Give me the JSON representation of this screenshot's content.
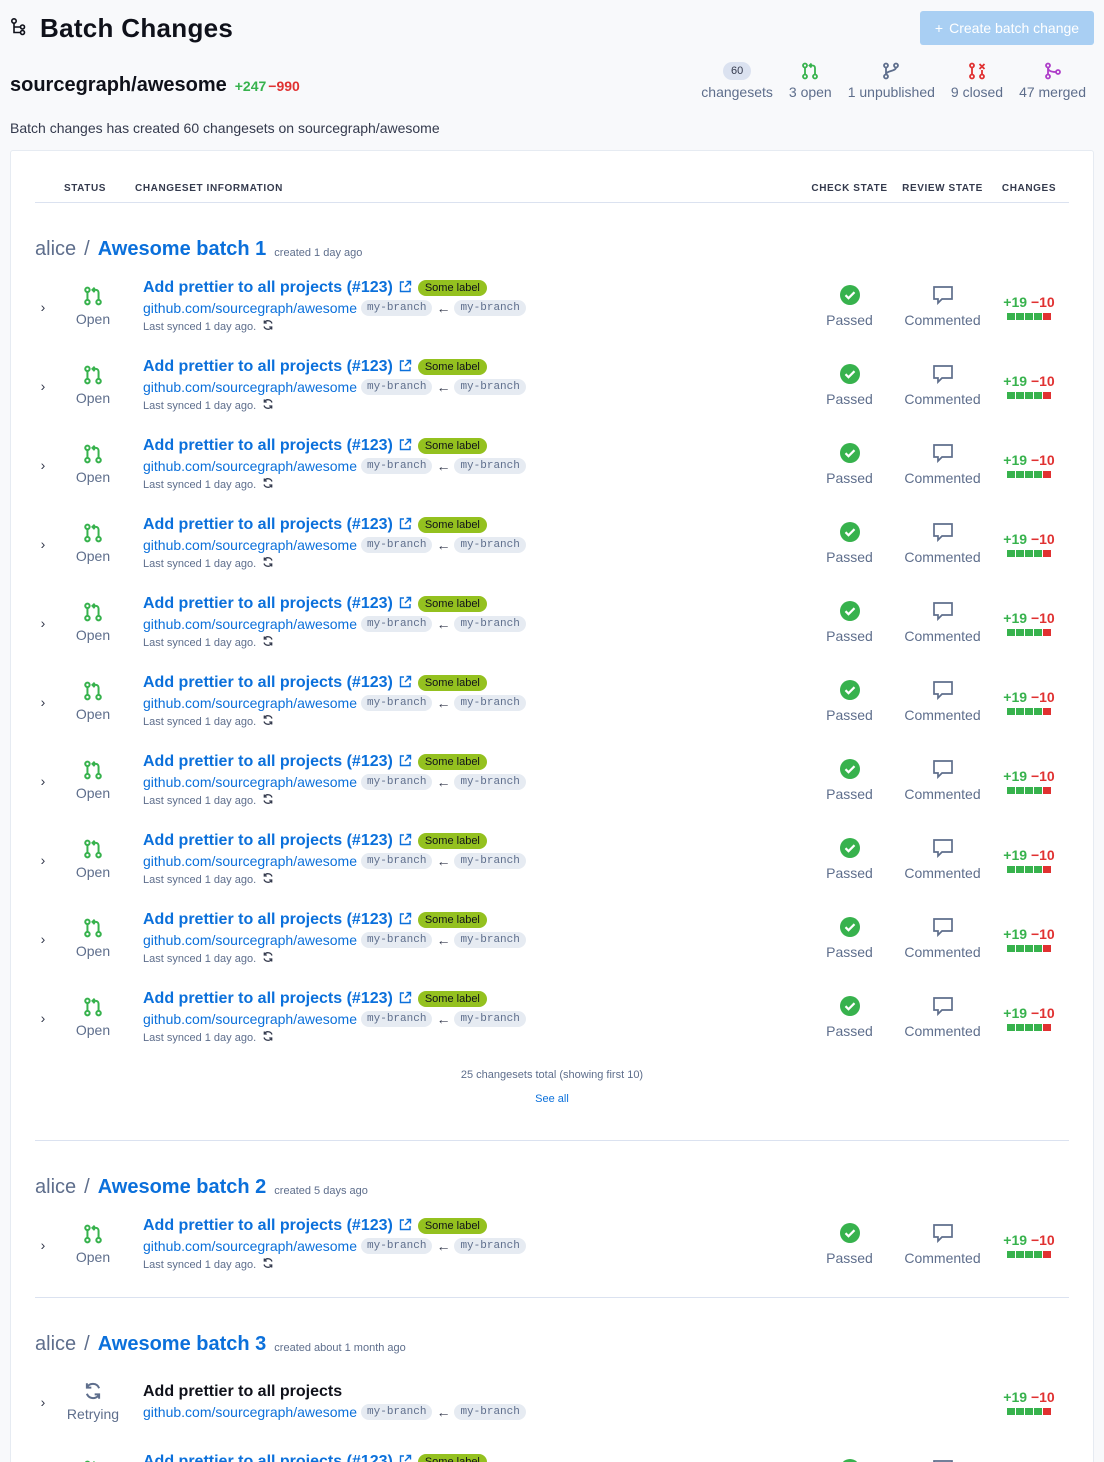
{
  "header": {
    "title": "Batch Changes",
    "create_label": "Create batch change"
  },
  "repo": {
    "name": "sourcegraph/awesome",
    "added": "+247",
    "removed": "−990"
  },
  "stats": [
    {
      "value": "60",
      "label": "changesets",
      "icon": "changesets-count-badge"
    },
    {
      "label": "3 open",
      "icon": "pull-request-open-icon",
      "color": "#37b24d"
    },
    {
      "label": "1 unpublished",
      "icon": "branch-unpublished-icon",
      "color": "#5e6e8c"
    },
    {
      "label": "9 closed",
      "icon": "pull-request-closed-icon",
      "color": "#e03131"
    },
    {
      "label": "47 merged",
      "icon": "merge-icon",
      "color": "#ae3ec9"
    }
  ],
  "description": "Batch changes has created 60 changesets on sourcegraph/awesome",
  "table": {
    "headers": {
      "status": "STATUS",
      "info": "CHANGESET INFORMATION",
      "check": "CHECK STATE",
      "review": "REVIEW STATE",
      "changes": "CHANGES"
    }
  },
  "common": {
    "status_open": "Open",
    "status_retrying": "Retrying",
    "title_pr": "Add prettier to all projects (#123)",
    "title_plain": "Add prettier to all projects",
    "label": "Some label",
    "repo": "github.com/sourcegraph/awesome",
    "branch_base": "my-branch",
    "branch_head": "my-branch",
    "arrow": "←",
    "synced": "Last synced 1 day ago.",
    "check": "Passed",
    "review": "Commented",
    "added": "+19",
    "removed": "−10"
  },
  "groups": [
    {
      "namespace": "alice",
      "sep": "/",
      "name": "Awesome batch 1",
      "created": "created 1 day ago",
      "footer_total": "25 changesets total (showing first 10)",
      "footer_link": "See all"
    },
    {
      "namespace": "alice",
      "sep": "/",
      "name": "Awesome batch 2",
      "created": "created 5 days ago"
    },
    {
      "namespace": "alice",
      "sep": "/",
      "name": "Awesome batch 3",
      "created": "created about 1 month ago"
    }
  ],
  "colors": {
    "accent": "#0b70db",
    "open": "#37b24d",
    "closed": "#e03131",
    "merged": "#ae3ec9",
    "label": "#94c11f"
  }
}
